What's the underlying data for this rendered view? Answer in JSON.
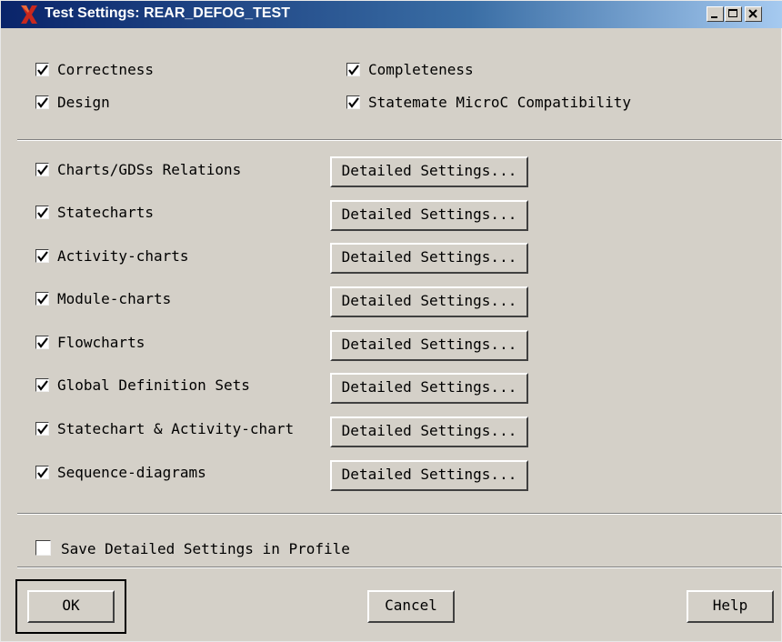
{
  "window": {
    "title": "Test Settings: REAR_DEFOG_TEST",
    "app_icon": "x-logo-icon",
    "controls": [
      "minimize-icon",
      "maximize-icon",
      "close-icon"
    ]
  },
  "general_checks": [
    {
      "label": "Correctness",
      "checked": true
    },
    {
      "label": "Completeness",
      "checked": true
    },
    {
      "label": "Design",
      "checked": true
    },
    {
      "label": "Statemate MicroC Compatibility",
      "checked": true
    }
  ],
  "chart_checks": [
    {
      "label": "Charts/GDSs Relations",
      "checked": true,
      "button": "Detailed Settings..."
    },
    {
      "label": "Statecharts",
      "checked": true,
      "button": "Detailed Settings..."
    },
    {
      "label": "Activity-charts",
      "checked": true,
      "button": "Detailed Settings..."
    },
    {
      "label": "Module-charts",
      "checked": true,
      "button": "Detailed Settings..."
    },
    {
      "label": "Flowcharts",
      "checked": true,
      "button": "Detailed Settings..."
    },
    {
      "label": "Global Definition Sets",
      "checked": true,
      "button": "Detailed Settings..."
    },
    {
      "label": "Statechart & Activity-chart",
      "checked": true,
      "button": "Detailed Settings..."
    },
    {
      "label": "Sequence-diagrams",
      "checked": true,
      "button": "Detailed Settings..."
    }
  ],
  "save_profile": {
    "label": "Save Detailed Settings in Profile",
    "checked": false
  },
  "buttons": {
    "ok": "OK",
    "cancel": "Cancel",
    "help": "Help"
  }
}
